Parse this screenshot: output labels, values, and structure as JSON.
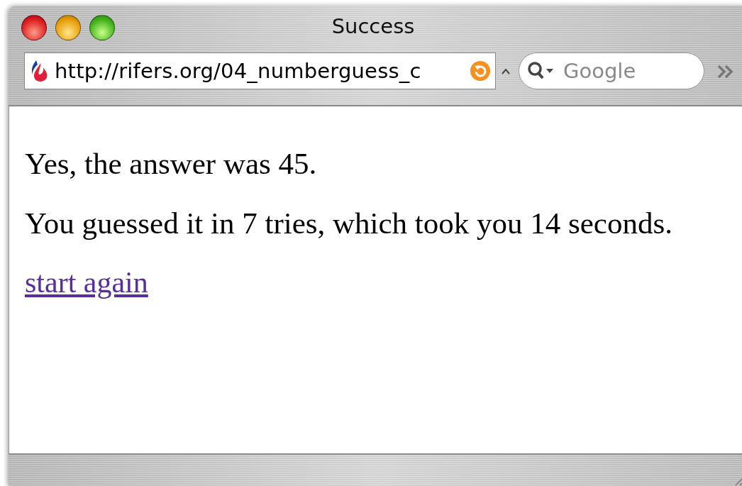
{
  "window": {
    "title": "Success"
  },
  "toolbar": {
    "address": "http://rifers.org/04_numberguess_c",
    "search": {
      "placeholder": "Google"
    }
  },
  "content": {
    "paragraphs": [
      "Yes, the answer was 45.",
      "You guessed it in 7 tries, which took you 14 seconds."
    ],
    "link": {
      "text": "start again",
      "visited": true
    }
  }
}
